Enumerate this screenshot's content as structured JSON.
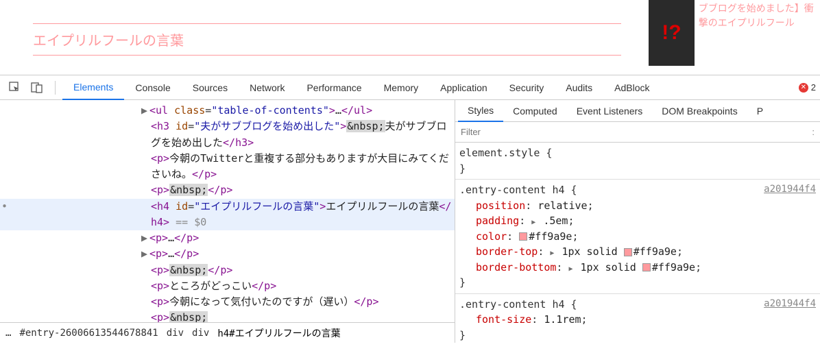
{
  "webpage": {
    "heading": "エイプリルフールの言葉",
    "sidebar_text": "ブブログを始めました】衝撃のエイプリルフール"
  },
  "devtools": {
    "tabs": [
      "Elements",
      "Console",
      "Sources",
      "Network",
      "Performance",
      "Memory",
      "Application",
      "Security",
      "Audits",
      "AdBlock"
    ],
    "active_tab": 0,
    "error_count": "2"
  },
  "dom": {
    "rows": [
      {
        "type": "collapsed",
        "arrow": true,
        "tag": "ul",
        "attr": "class",
        "val": "table-of-contents",
        "ellipsis": "…",
        "close": "ul"
      },
      {
        "type": "open",
        "tag": "h3",
        "attr": "id",
        "val": "夫がサブブログを始め出した",
        "pre_nbsp": true,
        "text": "夫がサブブログを始め出した",
        "close": "h3"
      },
      {
        "type": "p",
        "text": "今朝のTwitterと重複する部分もありますが大目にみてくださいね。"
      },
      {
        "type": "p_nbsp"
      },
      {
        "type": "h4_selected",
        "tag": "h4",
        "attr": "id",
        "val": "エイプリルフールの言葉",
        "text": "エイプリルフールの言葉",
        "close": "h4",
        "suffix": " == $0"
      },
      {
        "type": "collapsed_p",
        "arrow": true
      },
      {
        "type": "collapsed_p",
        "arrow": true
      },
      {
        "type": "p_nbsp"
      },
      {
        "type": "p",
        "text": "ところがどっこい"
      },
      {
        "type": "p",
        "text": "今朝になって気付いたのですが（遅い）"
      },
      {
        "type": "p_nbsp_cut"
      }
    ]
  },
  "breadcrumb": {
    "items": [
      "…",
      "#entry-26006613544678841",
      "div",
      "div",
      "h4#エイプリルフールの言葉"
    ]
  },
  "styles": {
    "tabs": [
      "Styles",
      "Computed",
      "Event Listeners",
      "DOM Breakpoints",
      "P"
    ],
    "active_tab": 0,
    "filter_placeholder": "Filter",
    "rules": [
      {
        "selector": "element.style",
        "src": "",
        "decls": []
      },
      {
        "selector": ".entry-content h4",
        "src": "a201944f4",
        "decls": [
          {
            "prop": "position",
            "val": "relative"
          },
          {
            "prop": "padding",
            "tri": true,
            "val": ".5em"
          },
          {
            "prop": "color",
            "swatch": "#ff9a9e",
            "val": "#ff9a9e"
          },
          {
            "prop": "border-top",
            "tri": true,
            "val_pre": "1px solid ",
            "swatch": "#ff9a9e",
            "val": "#ff9a9e"
          },
          {
            "prop": "border-bottom",
            "tri": true,
            "val_pre": "1px solid ",
            "swatch": "#ff9a9e",
            "val": "#ff9a9e"
          }
        ]
      },
      {
        "selector": ".entry-content h4",
        "src": "a201944f4",
        "decls": [
          {
            "prop": "font-size",
            "val": "1.1rem"
          }
        ]
      }
    ]
  }
}
